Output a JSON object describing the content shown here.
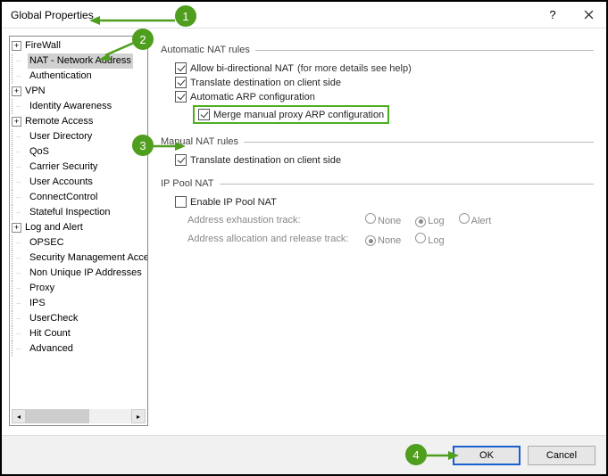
{
  "window": {
    "title": "Global Properties"
  },
  "tree": {
    "items": [
      {
        "label": "FireWall",
        "expandable": true,
        "depth": 0
      },
      {
        "label": "NAT - Network Address",
        "expandable": false,
        "depth": 1,
        "selected": true
      },
      {
        "label": "Authentication",
        "expandable": false,
        "depth": 1
      },
      {
        "label": "VPN",
        "expandable": true,
        "depth": 0
      },
      {
        "label": "Identity Awareness",
        "expandable": false,
        "depth": 1
      },
      {
        "label": "Remote Access",
        "expandable": true,
        "depth": 0
      },
      {
        "label": "User Directory",
        "expandable": false,
        "depth": 1
      },
      {
        "label": "QoS",
        "expandable": false,
        "depth": 1
      },
      {
        "label": "Carrier Security",
        "expandable": false,
        "depth": 1
      },
      {
        "label": "User Accounts",
        "expandable": false,
        "depth": 1
      },
      {
        "label": "ConnectControl",
        "expandable": false,
        "depth": 1
      },
      {
        "label": "Stateful Inspection",
        "expandable": false,
        "depth": 1
      },
      {
        "label": "Log and Alert",
        "expandable": true,
        "depth": 0
      },
      {
        "label": "OPSEC",
        "expandable": false,
        "depth": 1
      },
      {
        "label": "Security Management Access",
        "expandable": false,
        "depth": 1
      },
      {
        "label": "Non Unique IP Addresses",
        "expandable": false,
        "depth": 1
      },
      {
        "label": "Proxy",
        "expandable": false,
        "depth": 1
      },
      {
        "label": "IPS",
        "expandable": false,
        "depth": 1
      },
      {
        "label": "UserCheck",
        "expandable": false,
        "depth": 1
      },
      {
        "label": "Hit Count",
        "expandable": false,
        "depth": 1
      },
      {
        "label": "Advanced",
        "expandable": false,
        "depth": 1
      }
    ]
  },
  "sections": {
    "auto": {
      "title": "Automatic NAT rules"
    },
    "manual": {
      "title": "Manual NAT rules"
    },
    "pool": {
      "title": "IP Pool NAT"
    }
  },
  "checks": {
    "bidir": {
      "label": "Allow bi-directional NAT",
      "checked": true,
      "hint": "(for more details see help)"
    },
    "transAuto": {
      "label": "Translate destination on client side",
      "checked": true
    },
    "arp": {
      "label": "Automatic ARP configuration",
      "checked": true
    },
    "mergeArp": {
      "label": "Merge manual proxy ARP configuration",
      "checked": true
    },
    "transManual": {
      "label": "Translate destination on client side",
      "checked": true
    },
    "enablePool": {
      "label": "Enable IP Pool NAT",
      "checked": false
    }
  },
  "poolOpts": {
    "exhaustion": {
      "label": "Address exhaustion track:",
      "value": "Log",
      "options": [
        "None",
        "Log",
        "Alert"
      ]
    },
    "allocation": {
      "label": "Address allocation and release track:",
      "value": "None",
      "options": [
        "None",
        "Log"
      ]
    }
  },
  "buttons": {
    "ok": "OK",
    "cancel": "Cancel"
  },
  "callouts": {
    "c1": "1",
    "c2": "2",
    "c3": "3",
    "c4": "4"
  }
}
